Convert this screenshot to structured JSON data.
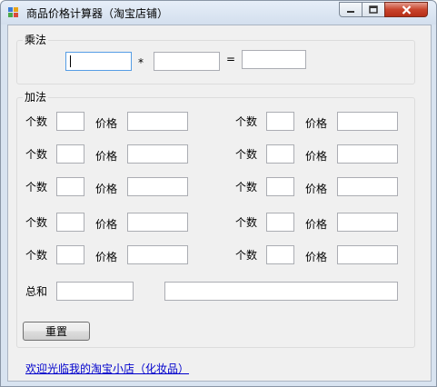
{
  "window": {
    "title": "商品价格计算器（淘宝店铺）"
  },
  "multiply": {
    "group_title": "乘法",
    "operator": "*",
    "equals": "=",
    "operand1_value": "",
    "operand2_value": "",
    "result_value": ""
  },
  "add": {
    "group_title": "加法",
    "rows": [
      {
        "left": {
          "qty_label": "个数",
          "price_label": "价格",
          "qty": "",
          "price": ""
        },
        "right": {
          "qty_label": "个数",
          "price_label": "价格",
          "qty": "",
          "price": ""
        }
      },
      {
        "left": {
          "qty_label": "个数",
          "price_label": "价格",
          "qty": "",
          "price": ""
        },
        "right": {
          "qty_label": "个数",
          "price_label": "价格",
          "qty": "",
          "price": ""
        }
      },
      {
        "left": {
          "qty_label": "个数",
          "price_label": "价格",
          "qty": "",
          "price": ""
        },
        "right": {
          "qty_label": "个数",
          "price_label": "价格",
          "qty": "",
          "price": ""
        }
      },
      {
        "left": {
          "qty_label": "个数",
          "price_label": "价格",
          "qty": "",
          "price": ""
        },
        "right": {
          "qty_label": "个数",
          "price_label": "价格",
          "qty": "",
          "price": ""
        }
      },
      {
        "left": {
          "qty_label": "个数",
          "price_label": "价格",
          "qty": "",
          "price": ""
        },
        "right": {
          "qty_label": "个数",
          "price_label": "价格",
          "qty": "",
          "price": ""
        }
      }
    ],
    "total_label": "总和",
    "total_value": "",
    "detail_value": "",
    "reset_label": "重置"
  },
  "footer": {
    "link_text": "欢迎光临我的淘宝小店（化妆品）"
  },
  "colors": {
    "accent_focus": "#569de5",
    "link": "#0000cc",
    "close_button": "#c9442c"
  },
  "icons": [
    "app-icon",
    "minimize-icon",
    "maximize-icon",
    "close-icon"
  ]
}
